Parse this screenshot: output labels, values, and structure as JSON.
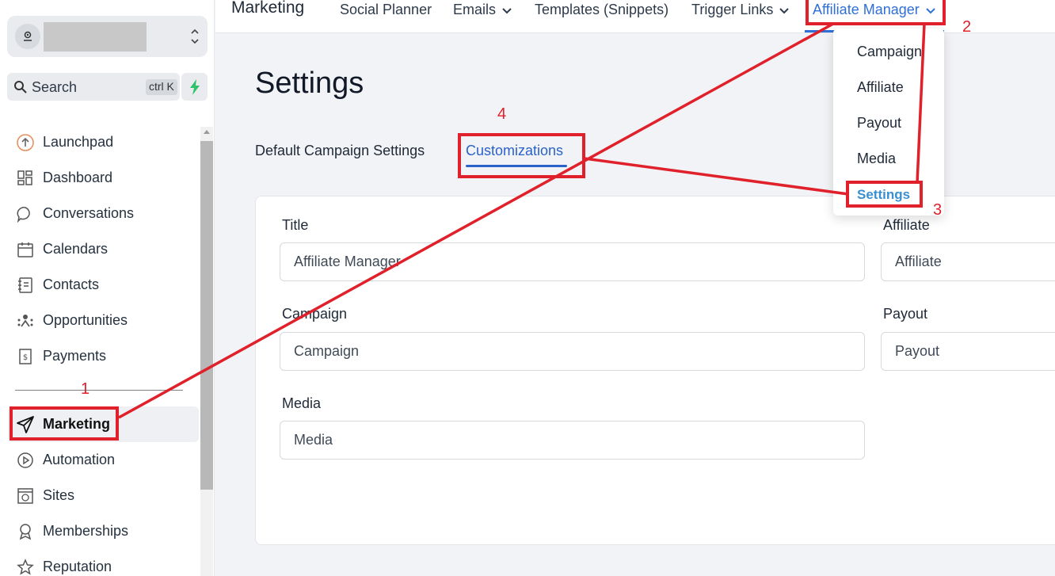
{
  "sidebar": {
    "search_label": "Search",
    "search_shortcut": "ctrl K",
    "items": [
      {
        "label": "Launchpad",
        "icon": "launchpad-icon"
      },
      {
        "label": "Dashboard",
        "icon": "dashboard-icon"
      },
      {
        "label": "Conversations",
        "icon": "chat-icon"
      },
      {
        "label": "Calendars",
        "icon": "calendar-icon"
      },
      {
        "label": "Contacts",
        "icon": "contacts-icon"
      },
      {
        "label": "Opportunities",
        "icon": "opportunities-icon"
      },
      {
        "label": "Payments",
        "icon": "payments-icon"
      }
    ],
    "items2": [
      {
        "label": "Marketing",
        "icon": "send-icon",
        "active": true
      },
      {
        "label": "Automation",
        "icon": "automation-icon"
      },
      {
        "label": "Sites",
        "icon": "sites-icon"
      },
      {
        "label": "Memberships",
        "icon": "badge-icon"
      },
      {
        "label": "Reputation",
        "icon": "star-icon"
      }
    ]
  },
  "topbar": {
    "title": "Marketing",
    "links": [
      {
        "label": "Social Planner",
        "dropdown": false
      },
      {
        "label": "Emails",
        "dropdown": true
      },
      {
        "label": "Templates (Snippets)",
        "dropdown": false
      },
      {
        "label": "Trigger Links",
        "dropdown": true
      },
      {
        "label": "Affiliate Manager",
        "dropdown": true,
        "active": true
      }
    ]
  },
  "dropdown": {
    "items": [
      "Campaign",
      "Affiliate",
      "Payout",
      "Media",
      "Settings"
    ],
    "active": "Settings"
  },
  "main": {
    "title": "Settings",
    "tabs": [
      {
        "label": "Default Campaign Settings"
      },
      {
        "label": "Customizations",
        "active": true
      }
    ],
    "fields": {
      "title": {
        "label": "Title",
        "value": "Affiliate Manager"
      },
      "affiliate": {
        "label": "Affiliate",
        "value": "Affiliate"
      },
      "campaign": {
        "label": "Campaign",
        "value": "Campaign"
      },
      "payout": {
        "label": "Payout",
        "value": "Payout"
      },
      "media": {
        "label": "Media",
        "value": "Media"
      }
    }
  },
  "annotations": {
    "n1": "1",
    "n2": "2",
    "n3": "3",
    "n4": "4"
  },
  "colors": {
    "accent": "#2f6fd6",
    "annotation": "#e0202a",
    "active_dropdown": "#3a8fd0"
  }
}
